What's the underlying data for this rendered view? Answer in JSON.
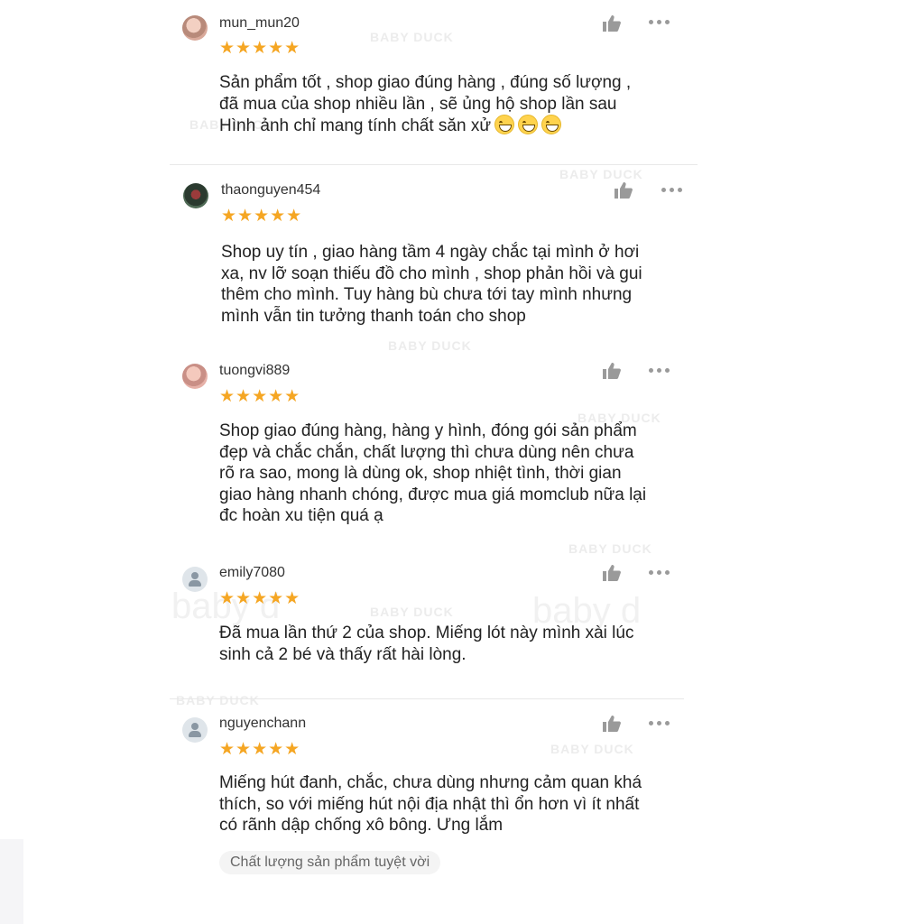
{
  "colors": {
    "star": "#f5a623",
    "icon": "#9a9a9a",
    "divider": "#e8e8e8",
    "chip_bg": "#f4f4f4"
  },
  "watermark": {
    "text_small": "BABY DUCK",
    "text_big": "baby d"
  },
  "reviews": [
    {
      "username": "mun_mun20",
      "avatar": "user-photo",
      "stars": "★★★★★",
      "rating": 5,
      "text": "Sản phẩm tốt , shop giao đúng hàng , đúng số lượng ,\nđã mua của shop nhiều lần , sẽ ủng hộ shop lần sau\nHình ảnh chỉ mang tính chất săn xử",
      "emoji": "grinning-face-emoji"
    },
    {
      "username": "thaonguyen454",
      "avatar": "user-photo",
      "stars": "★★★★★",
      "rating": 5,
      "text": "Shop uy tín , giao hàng tầm 4 ngày chắc tại mình ở hơi\nxa, nv lỡ soạn thiếu đồ cho mình , shop phản hồi và gui\nthêm cho mình. Tuy hàng bù chưa tới tay mình nhưng\nmình vẫn tin tưởng thanh toán cho shop"
    },
    {
      "username": "tuongvi889",
      "avatar": "user-photo",
      "stars": "★★★★★",
      "rating": 5,
      "text": "Shop giao đúng hàng, hàng y hình, đóng gói sản phẩm\nđẹp và chắc chắn, chất lượng thì chưa dùng nên chưa\nrõ ra sao, mong là dùng ok, shop nhiệt tình, thời gian\ngiao hàng nhanh chóng, được mua giá momclub nữa lại\nđc hoàn xu tiện quá ạ"
    },
    {
      "username": "emily7080",
      "avatar": "default-avatar",
      "stars": "★★★★★",
      "rating": 5,
      "text": "Đã mua lần thứ 2 của shop. Miếng lót này mình xài lúc\nsinh cả 2 bé và thấy rất hài lòng."
    },
    {
      "username": "nguyenchann",
      "avatar": "default-avatar",
      "stars": "★★★★★",
      "rating": 5,
      "text": "Miếng hút đanh, chắc, chưa dùng nhưng cảm quan khá\nthích, so với miếng hút nội địa nhật thì ổn hơn vì ít nhất\ncó rãnh dập chống xô bông. Ưng lắm",
      "tag": "Chất lượng sản phẩm tuyệt vời"
    }
  ]
}
